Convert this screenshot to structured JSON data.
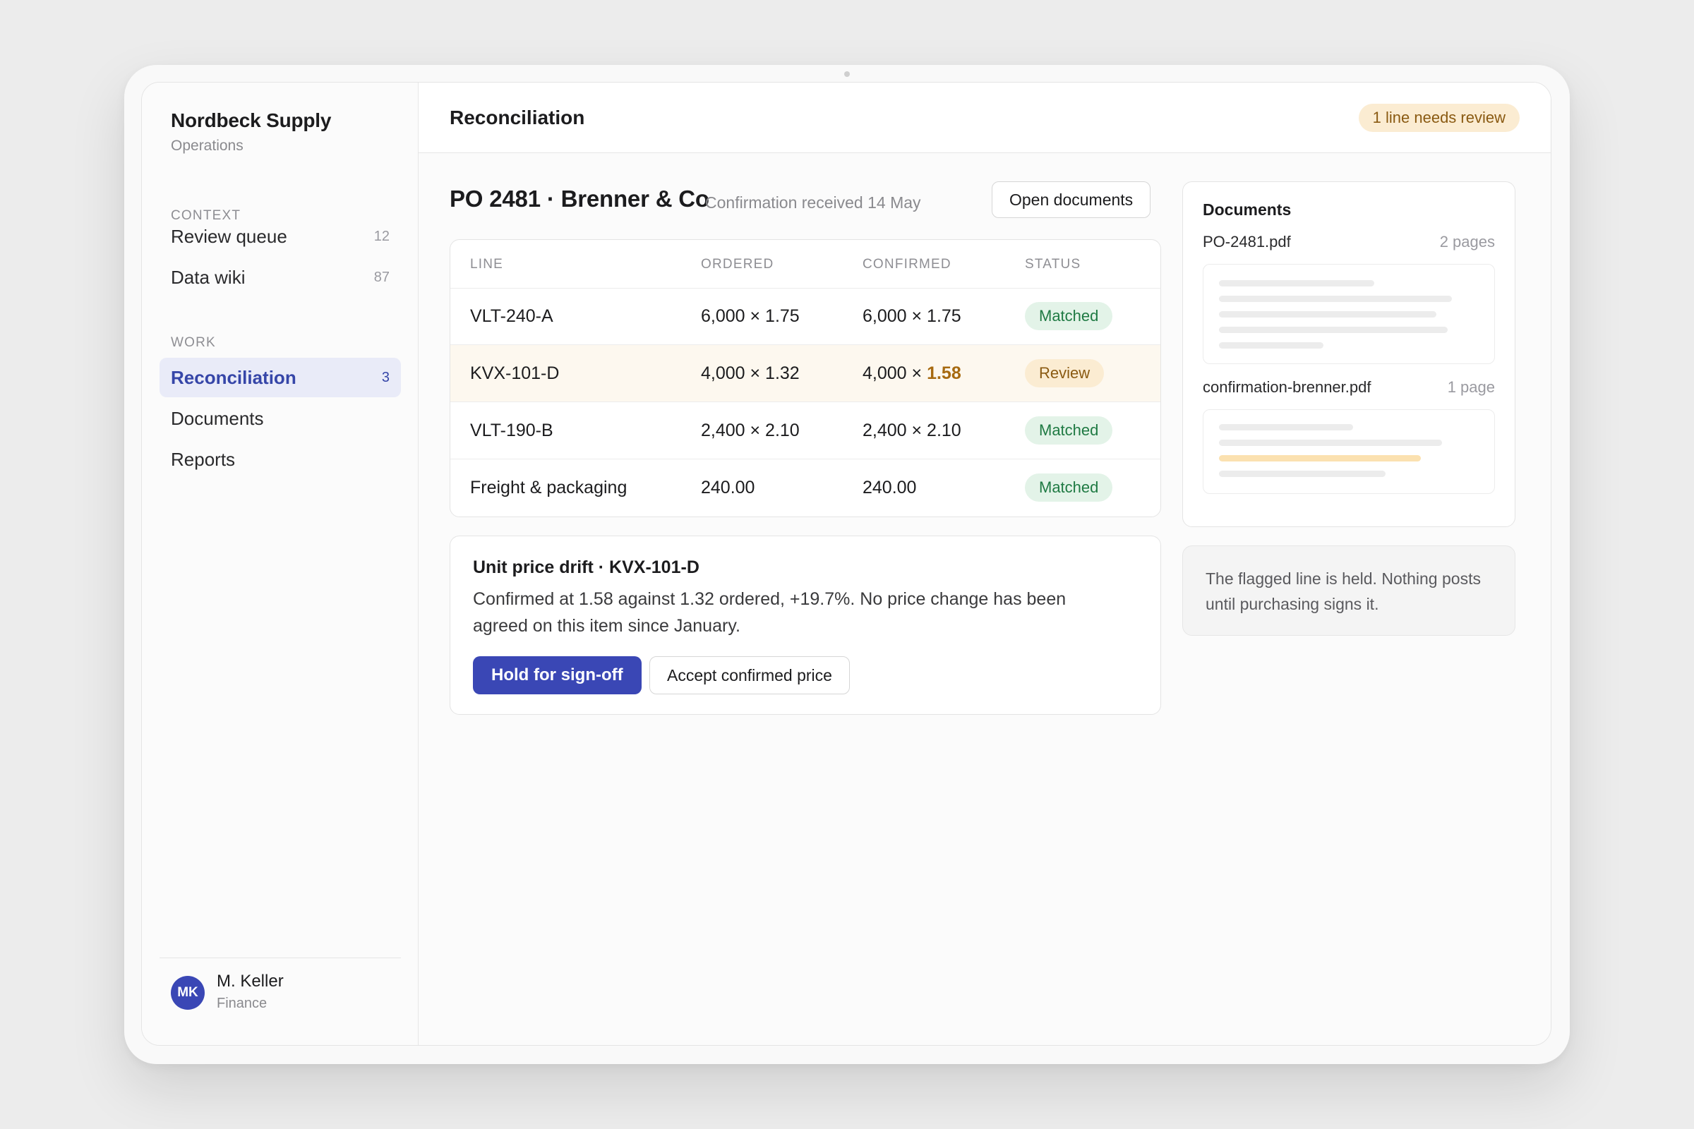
{
  "sidebar": {
    "brand_title": "Nordbeck Supply",
    "brand_subtitle": "Operations",
    "sections": [
      {
        "label": "CONTEXT",
        "items": [
          {
            "label": "Review queue",
            "count": "12"
          },
          {
            "label": "Data wiki",
            "count": "87"
          }
        ]
      },
      {
        "label": "WORK",
        "items": [
          {
            "label": "Reconciliation",
            "count": "3",
            "active": true
          },
          {
            "label": "Documents",
            "count": ""
          },
          {
            "label": "Reports",
            "count": ""
          }
        ]
      }
    ],
    "user": {
      "initials": "MK",
      "name": "M. Keller",
      "role": "Finance"
    }
  },
  "header": {
    "title": "Reconciliation",
    "review_badge": "1 line needs review"
  },
  "po": {
    "title": "PO 2481 · Brenner & Co",
    "subtitle": "Confirmation received 14 May",
    "open_documents_label": "Open documents"
  },
  "table": {
    "columns": [
      "LINE",
      "ORDERED",
      "CONFIRMED",
      "STATUS"
    ],
    "rows": [
      {
        "line": "VLT-240-A",
        "ordered": "6,000 × 1.75",
        "confirmed_prefix": "6,000 × 1.75",
        "confirmed_highlight": "",
        "status": "Matched"
      },
      {
        "line": "KVX-101-D",
        "ordered": "4,000 × 1.32",
        "confirmed_prefix": "4,000 × ",
        "confirmed_highlight": "1.58",
        "status": "Review"
      },
      {
        "line": "VLT-190-B",
        "ordered": "2,400 × 2.10",
        "confirmed_prefix": "2,400 × 2.10",
        "confirmed_highlight": "",
        "status": "Matched"
      },
      {
        "line": "Freight & packaging",
        "ordered": "240.00",
        "confirmed_prefix": "240.00",
        "confirmed_highlight": "",
        "status": "Matched"
      }
    ]
  },
  "drift": {
    "title": "Unit price drift · KVX-101-D",
    "body": "Confirmed at 1.58 against 1.32 ordered, +19.7%. No price change has been agreed on this item since January.",
    "primary_action": "Hold for sign-off",
    "secondary_action": "Accept confirmed price"
  },
  "documents": {
    "title": "Documents",
    "files": [
      {
        "name": "PO-2481.pdf",
        "pages": "2 pages"
      },
      {
        "name": "confirmation-brenner.pdf",
        "pages": "1 page"
      }
    ]
  },
  "note": {
    "text": "The flagged line is held. Nothing posts until purchasing signs it."
  },
  "colors": {
    "accent": "#3a47b5",
    "matched_bg": "#e3f3e8",
    "matched_text": "#1f7a43",
    "review_bg": "#fbecd2",
    "review_text": "#8a5a12",
    "highlight_text": "#a76a10"
  }
}
